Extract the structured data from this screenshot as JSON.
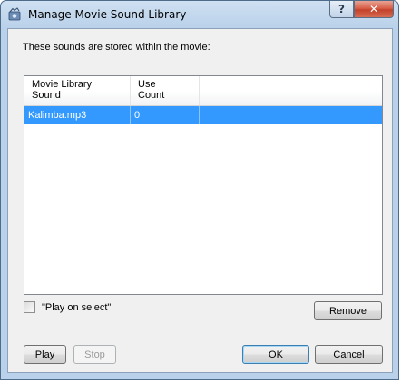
{
  "window": {
    "title": "Manage Movie Sound Library",
    "help_label": "?",
    "close_label": "✕"
  },
  "description": "These sounds are stored within the movie:",
  "list": {
    "columns": [
      "Movie Library\nSound",
      "Use\nCount",
      ""
    ],
    "rows": [
      {
        "sound": "Kalimba.mp3",
        "use_count": "0",
        "selected": true
      }
    ]
  },
  "play_on_select": {
    "label": "\"Play on select\"",
    "checked": false
  },
  "buttons": {
    "remove": "Remove",
    "play": "Play",
    "stop": "Stop",
    "ok": "OK",
    "cancel": "Cancel"
  },
  "colors": {
    "selection": "#3399ff",
    "titlebar": "#b9d1ea",
    "close": "#c3412b"
  }
}
